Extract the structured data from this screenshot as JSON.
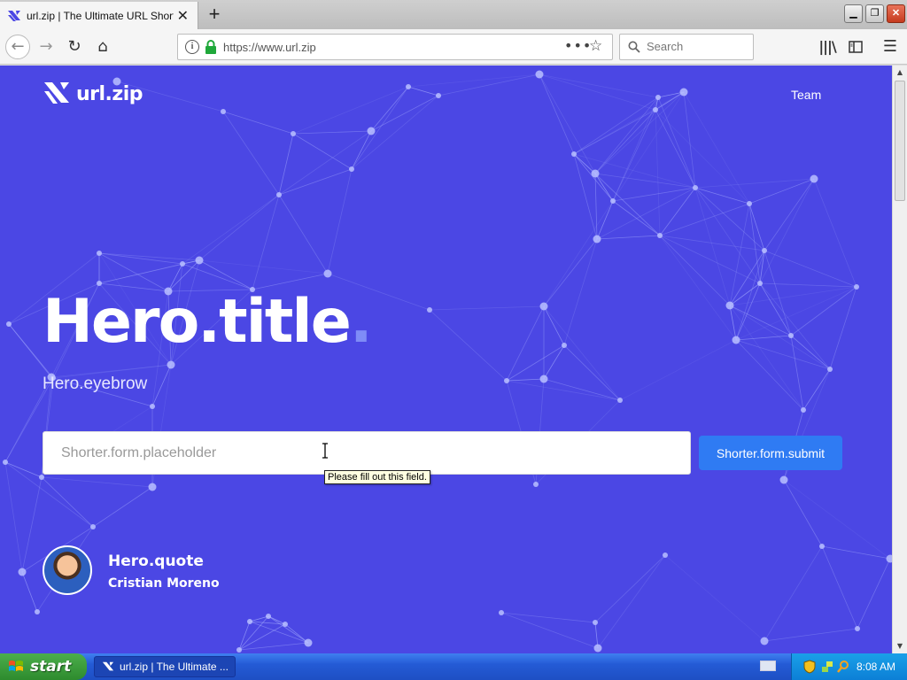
{
  "browser": {
    "tab_title": "url.zip | The Ultimate URL Shorten",
    "tab_close": "✕",
    "new_tab": "+",
    "url": "https://www.url.zip",
    "search_placeholder": "Search"
  },
  "page": {
    "logo_text": "url.zip",
    "nav_team": "Team",
    "hero_title": "Hero.title",
    "hero_title_dot": ".",
    "hero_eyebrow": "Hero.eyebrow",
    "input_placeholder": "Shorter.form.placeholder",
    "submit_label": "Shorter.form.submit",
    "tooltip": "Please fill out this field.",
    "quote": "Hero.quote",
    "author": "Cristian Moreno"
  },
  "taskbar": {
    "start_label": "start",
    "task_label": "url.zip | The Ultimate ...",
    "clock": "8:08 AM"
  },
  "colors": {
    "hero_bg": "#4b47e4",
    "submit_bg": "#2f7bf3",
    "accent_dot": "#7f8cf7"
  }
}
